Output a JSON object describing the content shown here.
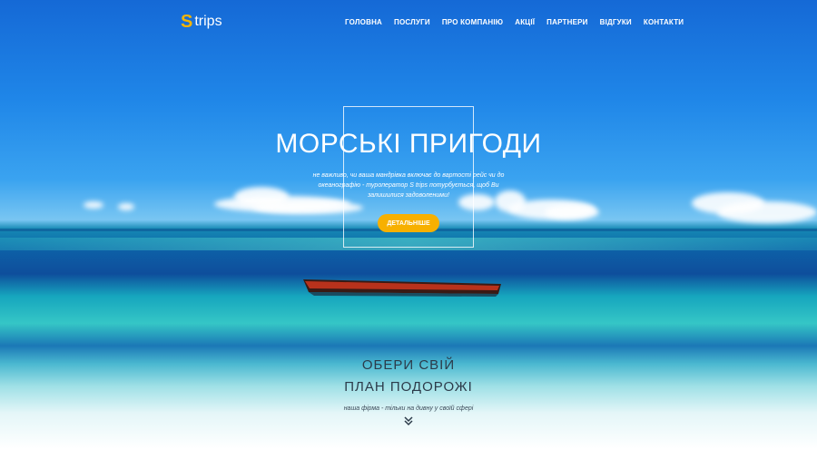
{
  "header": {
    "logo_mark": "S",
    "logo_text": "trips",
    "nav": [
      {
        "label": "ГОЛОВНА"
      },
      {
        "label": "ПОСЛУГИ"
      },
      {
        "label": "ПРО КОМПАНІЮ"
      },
      {
        "label": "АКЦІЇ"
      },
      {
        "label": "ПАРТНЕРИ"
      },
      {
        "label": "ВІДГУКИ"
      },
      {
        "label": "КОНТАКТИ"
      }
    ]
  },
  "hero": {
    "title": "МОРСЬКІ ПРИГОДИ",
    "subtitle": "не важливо, чи ваша мандрівка включає до вартості рейс чи до океанографію - туроператор S trips потурбується, щоб Ви залишилися задоволеними!",
    "cta_label": "ДЕТАЛЬНІШЕ"
  },
  "plan": {
    "line1": "ОБЕРИ СВІЙ",
    "line2": "ПЛАН ПОДОРОЖІ",
    "tagline": "наша фірма - тільки на дивну у своїй сфері"
  },
  "colors": {
    "accent": "#f7b000",
    "sky": "#1f86e8",
    "text_dark": "#2c3b4a"
  }
}
